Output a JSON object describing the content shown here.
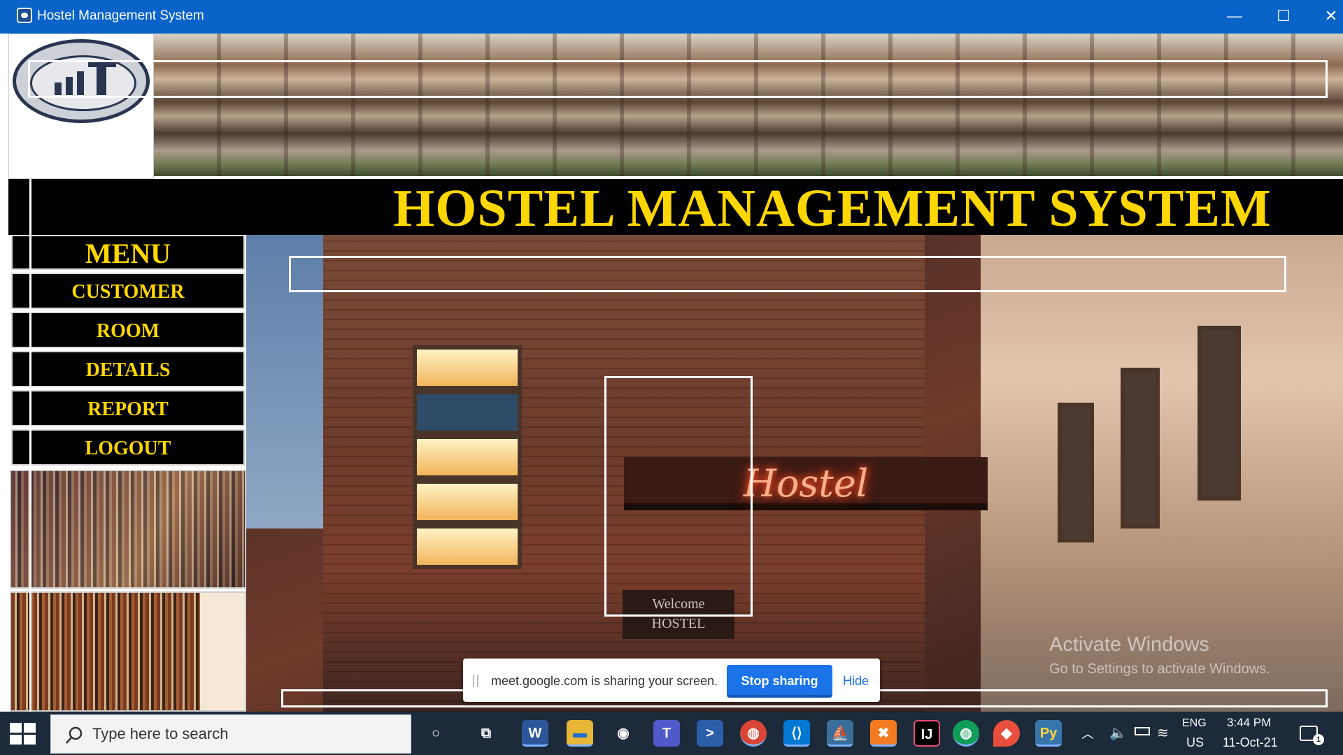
{
  "window": {
    "title": "Hostel Management System",
    "controls": {
      "minimize": "—",
      "maximize": "☐",
      "close": "✕"
    }
  },
  "header": {
    "heading": "HOSTEL MANAGEMENT SYSTEM"
  },
  "menu": {
    "title": "MENU",
    "items": [
      {
        "label": "CUSTOMER"
      },
      {
        "label": "ROOM"
      },
      {
        "label": "DETAILS"
      },
      {
        "label": "REPORT"
      },
      {
        "label": "LOGOUT"
      }
    ]
  },
  "main": {
    "sign_text": "Hostel",
    "welcome_text": "Welcome",
    "welcome_sub": "HOSTEL"
  },
  "watermark": {
    "line1": "Activate Windows",
    "line2": "Go to Settings to activate Windows."
  },
  "share_bar": {
    "message": "meet.google.com is sharing your screen.",
    "stop_label": "Stop sharing",
    "hide_label": "Hide"
  },
  "taskbar": {
    "search_placeholder": "Type here to search",
    "apps": [
      {
        "name": "cortana-icon",
        "glyph": "○"
      },
      {
        "name": "task-view-icon",
        "glyph": "⧉"
      },
      {
        "name": "word-icon",
        "glyph": "W"
      },
      {
        "name": "file-explorer-icon",
        "glyph": "▬"
      },
      {
        "name": "media-icon",
        "glyph": "◉"
      },
      {
        "name": "teams-icon",
        "glyph": "T"
      },
      {
        "name": "powershell-icon",
        "glyph": ">"
      },
      {
        "name": "chrome-icon",
        "glyph": "◍"
      },
      {
        "name": "vscode-icon",
        "glyph": "⟨⟩"
      },
      {
        "name": "mysql-icon",
        "glyph": "⛵"
      },
      {
        "name": "xampp-icon",
        "glyph": "✖"
      },
      {
        "name": "intellij-icon",
        "glyph": "IJ"
      },
      {
        "name": "chrome-icon-2",
        "glyph": "◍"
      },
      {
        "name": "maps-icon",
        "glyph": "◆"
      },
      {
        "name": "python-icon",
        "glyph": "Py"
      }
    ],
    "language_1": "ENG",
    "language_2": "US",
    "time": "3:44 PM",
    "date": "11-Oct-21",
    "notification_count": "1"
  },
  "colors": {
    "accent": "#ffd700",
    "titlebar": "#0a63c9",
    "taskbar": "#1c2a3a",
    "share_button": "#1a73e8"
  }
}
